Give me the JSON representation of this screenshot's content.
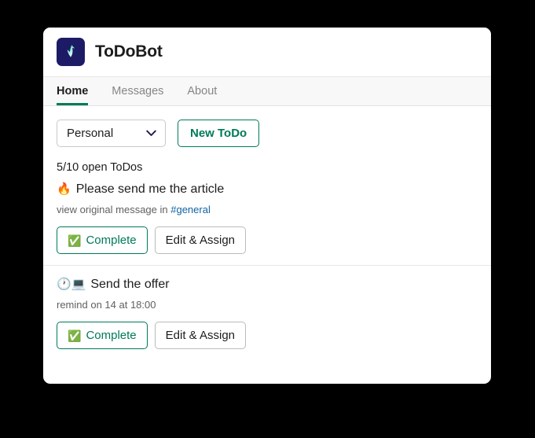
{
  "app": {
    "title": "ToDoBot",
    "logo_icon": "todobot-check-logo",
    "logo_bg": "#1e1b66",
    "logo_accent": "#2bd4a8"
  },
  "tabs": [
    {
      "label": "Home",
      "active": true
    },
    {
      "label": "Messages",
      "active": false
    },
    {
      "label": "About",
      "active": false
    }
  ],
  "controls": {
    "scope_select": {
      "value": "Personal",
      "chevron_icon": "chevron-down-icon"
    },
    "new_todo_button": {
      "label": "New ToDo",
      "color": "#007a5a"
    }
  },
  "summary": {
    "open_count_text": "5/10 open ToDos"
  },
  "todos": [
    {
      "emoji": "🔥",
      "emoji_name": "fire-emoji",
      "title": "Please send me the article",
      "meta_prefix": "view original message in ",
      "meta_link": "#general",
      "link_color": "#1264a3",
      "complete_label": "Complete",
      "complete_emoji": "✅",
      "edit_label": "Edit & Assign"
    },
    {
      "emoji": "🕐💻",
      "emoji_name": "clock-laptop-emoji",
      "title": "Send the offer",
      "meta_prefix": "remind on 14 at 18:00",
      "meta_link": "",
      "link_color": "#1264a3",
      "complete_label": "Complete",
      "complete_emoji": "✅",
      "edit_label": "Edit & Assign"
    }
  ],
  "theme": {
    "background": "#000000",
    "card_background": "#ffffff",
    "tabbar_background": "#f8f8f8",
    "accent_green": "#007a5a",
    "divider": "#e8e8e8"
  }
}
